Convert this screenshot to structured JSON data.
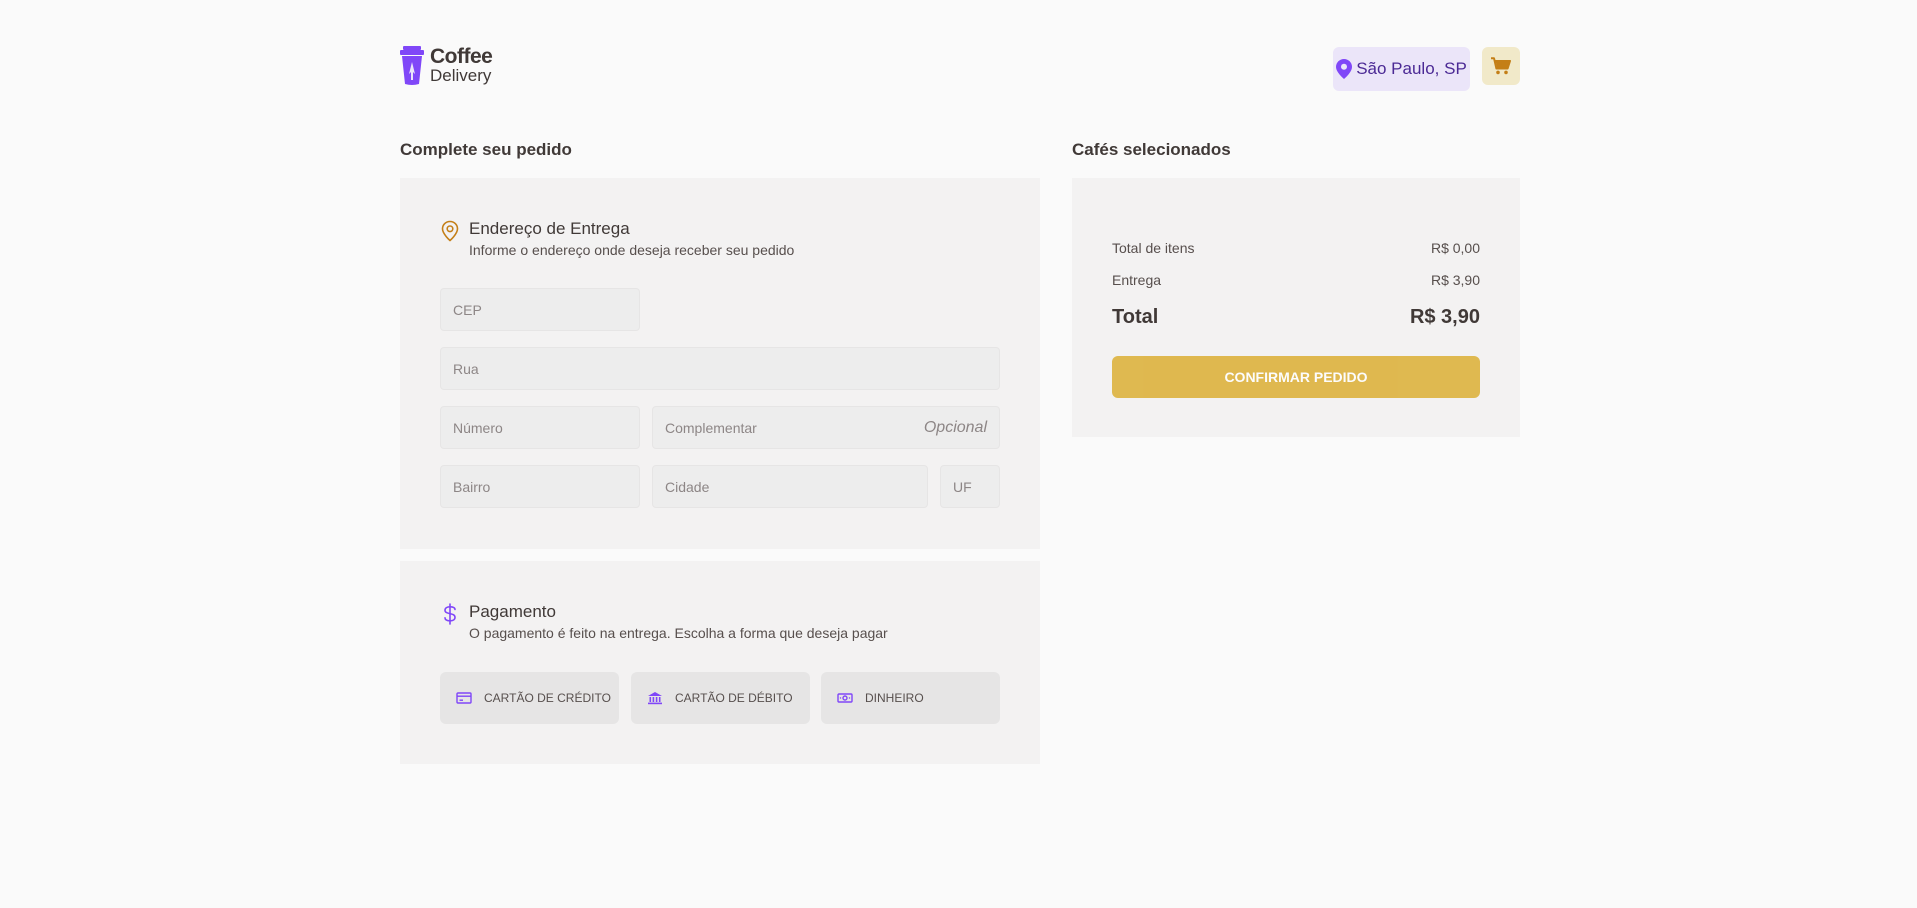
{
  "header": {
    "logo": {
      "line1": "Coffee",
      "line2": "Delivery"
    },
    "location": {
      "label": "São Paulo, SP",
      "icon": "map-pin-icon"
    },
    "cart": {
      "icon": "shopping-cart-icon"
    }
  },
  "checkout": {
    "title": "Complete seu pedido",
    "address": {
      "title": "Endereço de Entrega",
      "subtitle": "Informe o endereço onde deseja receber seu pedido",
      "icon": "map-pin-outline-icon",
      "fields": {
        "cep": "CEP",
        "rua": "Rua",
        "numero": "Número",
        "complemento": "Complementar",
        "complemento_optional": "Opcional",
        "bairro": "Bairro",
        "cidade": "Cidade",
        "uf": "UF"
      }
    },
    "payment": {
      "title": "Pagamento",
      "subtitle": "O pagamento é feito na entrega. Escolha a forma que deseja pagar",
      "icon": "currency-dollar-icon",
      "options": [
        {
          "label": "CARTÃO DE CRÉDITO",
          "icon": "credit-card-icon"
        },
        {
          "label": "CARTÃO DE DÉBITO",
          "icon": "bank-icon"
        },
        {
          "label": "DINHEIRO",
          "icon": "money-icon"
        }
      ]
    }
  },
  "summary": {
    "title": "Cafés selecionados",
    "items_label": "Total de itens",
    "items_value": "R$ 0,00",
    "delivery_label": "Entrega",
    "delivery_value": "R$ 3,90",
    "total_label": "Total",
    "total_value": "R$ 3,90",
    "confirm_label": "CONFIRMAR PEDIDO"
  },
  "colors": {
    "purple": "#8047F8",
    "purple_dark": "#4B2995",
    "purple_light": "#EBE5F9",
    "yellow": "#DBAC2C",
    "yellow_dark": "#C47F17",
    "yellow_light": "#F1E9C9",
    "background": "#FAFAFA",
    "card": "#F3F2F2"
  }
}
